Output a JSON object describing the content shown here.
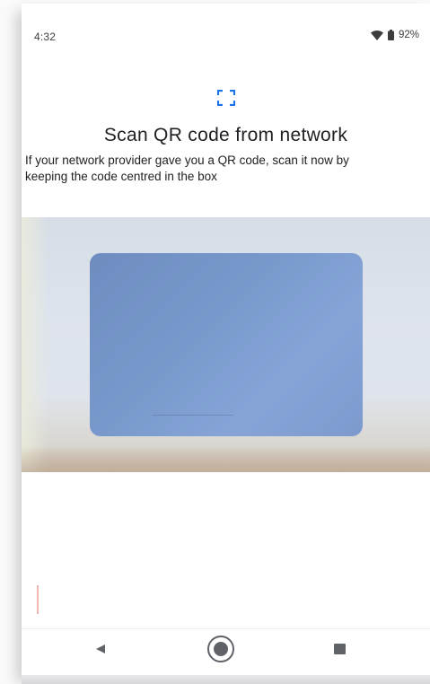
{
  "status_bar": {
    "time": "4:32",
    "battery_percent": "92%",
    "wifi_icon": "wifi-icon",
    "battery_icon": "battery-icon"
  },
  "header": {
    "icon": "qr-scan-frame-icon",
    "accent_color": "#1a73e8",
    "title": "Scan QR code from network",
    "description": "If your network provider gave you a QR code, scan it now by keeping the code centred in the box"
  },
  "camera": {
    "scan_box_color": "#7898cb"
  },
  "nav_bar": {
    "back_icon": "back-triangle-icon",
    "home_icon": "home-circle-icon",
    "recents_icon": "recents-square-icon"
  }
}
